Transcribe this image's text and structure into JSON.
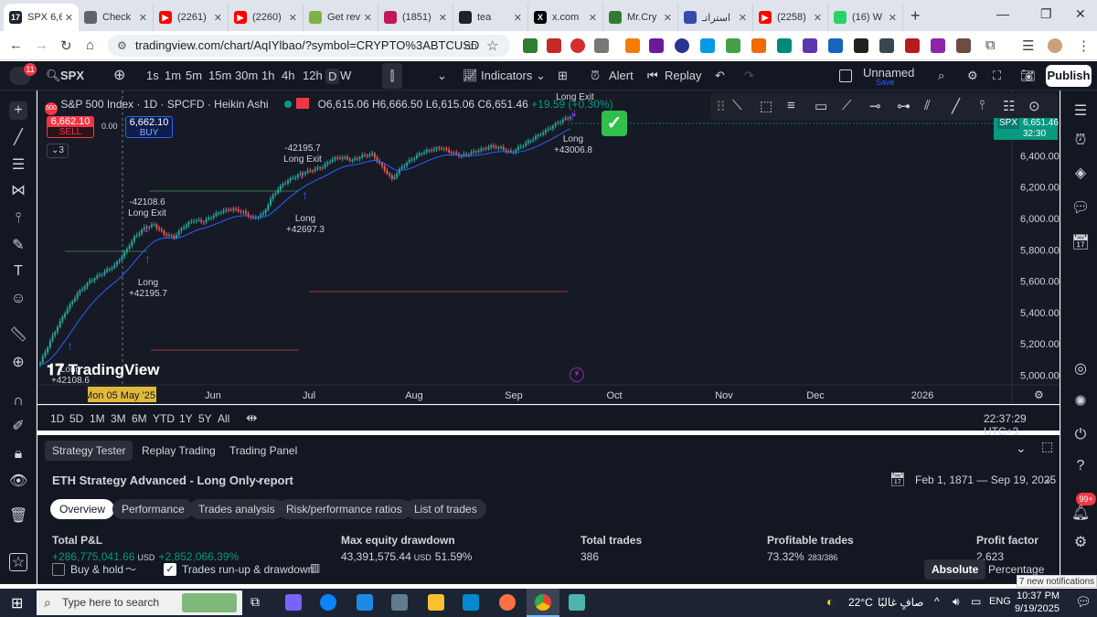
{
  "browser": {
    "tabs": [
      {
        "title": "SPX 6,6",
        "fav": "#1e222d",
        "favtext": "17",
        "active": true
      },
      {
        "title": "Check",
        "fav": "#5f6368",
        "favtext": ""
      },
      {
        "title": "(2261)",
        "fav": "#ff0000",
        "favtext": "▶"
      },
      {
        "title": "(2260)",
        "fav": "#ff0000",
        "favtext": "▶"
      },
      {
        "title": "Get rev",
        "fav": "#7cb342",
        "favtext": ""
      },
      {
        "title": "(1851)",
        "fav": "#c2185b",
        "favtext": ""
      },
      {
        "title": "tea",
        "fav": "#202124",
        "favtext": ""
      },
      {
        "title": "x.com",
        "fav": "#000000",
        "favtext": "X"
      },
      {
        "title": "Mr.Cry",
        "fav": "#2e7d32",
        "favtext": ""
      },
      {
        "title": "استراتـ",
        "fav": "#3949ab",
        "favtext": ""
      },
      {
        "title": "(2258)",
        "fav": "#ff0000",
        "favtext": "▶"
      },
      {
        "title": "(16) W",
        "fav": "#25d366",
        "favtext": ""
      }
    ],
    "new_tab": "+",
    "url": "tradingview.com/chart/AqIYlbao/?symbol=CRYPTO%3ABTCUSD"
  },
  "toolbar": {
    "notif_count": "11",
    "symbol": "SPX",
    "intervals": [
      "1s",
      "1m",
      "5m",
      "15m",
      "30m",
      "1h",
      "4h",
      "12h",
      "D",
      "W"
    ],
    "indicators": "Indicators",
    "alert": "Alert",
    "replay": "Replay",
    "layout_name": "Unnamed",
    "layout_status": "Save",
    "publish": "Publish"
  },
  "legend": {
    "title": "S&P 500 Index · 1D · SPCFD · Heikin Ashi",
    "o": "O6,615.06",
    "h": "H6,666.50",
    "l": "L6,615.06",
    "c": "C6,651.46",
    "chg": "+19.59 (+0.30%)",
    "sell_price": "6,662.10",
    "sell_label": "SELL",
    "spread": "0.00",
    "buy_price": "6,662.10",
    "buy_label": "BUY",
    "indicators_count": "3"
  },
  "price_tag": {
    "symbol": "SPX",
    "price": "6,651.46",
    "countdown": "32:30"
  },
  "chart_data": {
    "type": "candlestick",
    "style": "Heikin Ashi",
    "price_axis": [
      "6,400.00",
      "6,200.00",
      "6,000.00",
      "5,800.00",
      "5,600.00",
      "5,400.00",
      "5,200.00",
      "5,000.00"
    ],
    "time_axis": [
      "Mon 05 May '25",
      "Jun",
      "Jul",
      "Aug",
      "Sep",
      "Oct",
      "Nov",
      "Dec",
      "2026"
    ],
    "ylim": [
      4950,
      6700
    ],
    "close_path": [
      [
        0,
        5080
      ],
      [
        5,
        5250
      ],
      [
        10,
        5400
      ],
      [
        15,
        5520
      ],
      [
        20,
        5600
      ],
      [
        25,
        5650
      ],
      [
        30,
        5700
      ],
      [
        34,
        5780
      ],
      [
        38,
        5880
      ],
      [
        42,
        5940
      ],
      [
        46,
        5960
      ],
      [
        50,
        5900
      ],
      [
        54,
        5880
      ],
      [
        58,
        5950
      ],
      [
        62,
        5990
      ],
      [
        66,
        5980
      ],
      [
        70,
        6020
      ],
      [
        74,
        6050
      ],
      [
        78,
        6060
      ],
      [
        82,
        6040
      ],
      [
        86,
        6000
      ],
      [
        90,
        6030
      ],
      [
        94,
        6150
      ],
      [
        98,
        6220
      ],
      [
        102,
        6260
      ],
      [
        106,
        6290
      ],
      [
        110,
        6310
      ],
      [
        114,
        6330
      ],
      [
        118,
        6380
      ],
      [
        122,
        6390
      ],
      [
        126,
        6370
      ],
      [
        130,
        6400
      ],
      [
        134,
        6410
      ],
      [
        138,
        6330
      ],
      [
        142,
        6250
      ],
      [
        146,
        6330
      ],
      [
        150,
        6380
      ],
      [
        154,
        6420
      ],
      [
        158,
        6440
      ],
      [
        162,
        6450
      ],
      [
        166,
        6420
      ],
      [
        170,
        6400
      ],
      [
        174,
        6420
      ],
      [
        178,
        6440
      ],
      [
        182,
        6460
      ],
      [
        186,
        6450
      ],
      [
        190,
        6420
      ],
      [
        194,
        6460
      ],
      [
        198,
        6500
      ],
      [
        202,
        6540
      ],
      [
        206,
        6580
      ],
      [
        210,
        6620
      ],
      [
        214,
        6651
      ]
    ],
    "annotations": [
      {
        "label": "Long",
        "value": "+42108.6"
      },
      {
        "label": "Long",
        "value": "+42195.7"
      },
      {
        "label": "Long Exit",
        "value": "-42108.6"
      },
      {
        "label": "Long",
        "value": "+42697.3"
      },
      {
        "label": "Long Exit",
        "value": "-42195.7"
      },
      {
        "label": "Long",
        "value": "+43006.8"
      },
      {
        "label": "Long Exit",
        "value": ""
      }
    ],
    "watermark": "TradingView"
  },
  "ranges": [
    "1D",
    "5D",
    "1M",
    "3M",
    "6M",
    "YTD",
    "1Y",
    "5Y",
    "All"
  ],
  "clock": "22:37:29 UTC+3",
  "panel": {
    "tabs": [
      "Strategy Tester",
      "Replay Trading",
      "Trading Panel"
    ],
    "report_title": "ETH Strategy Advanced - Long Only report",
    "date_range": "Feb 1, 1871 — Sep 19, 2025",
    "subtabs": [
      "Overview",
      "Performance",
      "Trades analysis",
      "Risk/performance ratios",
      "List of trades"
    ],
    "metrics": [
      {
        "label": "Total P&L",
        "value": "+286,775,041.66",
        "unit": "USD",
        "extra": "+2,852,066.39%"
      },
      {
        "label": "Max equity drawdown",
        "value": "43,391,575.44",
        "unit": "USD",
        "extra": "51.59%"
      },
      {
        "label": "Total trades",
        "value": "386",
        "unit": "",
        "extra": ""
      },
      {
        "label": "Profitable trades",
        "value": "73.32%",
        "unit": "",
        "extra": "283/386"
      },
      {
        "label": "Profit factor",
        "value": "2.623",
        "unit": "",
        "extra": ""
      }
    ],
    "buy_hold": "Buy & hold",
    "runup": "Trades run-up & drawdown",
    "absolute": "Absolute",
    "percentage": "Percentage",
    "notifications": "7 new notifications",
    "badge": "99+"
  },
  "taskbar": {
    "search": "Type here to search",
    "weather": "22°C",
    "weather_desc": "صافٍ غالبًا",
    "lang": "ENG",
    "time": "10:37 PM",
    "date": "9/19/2025"
  }
}
